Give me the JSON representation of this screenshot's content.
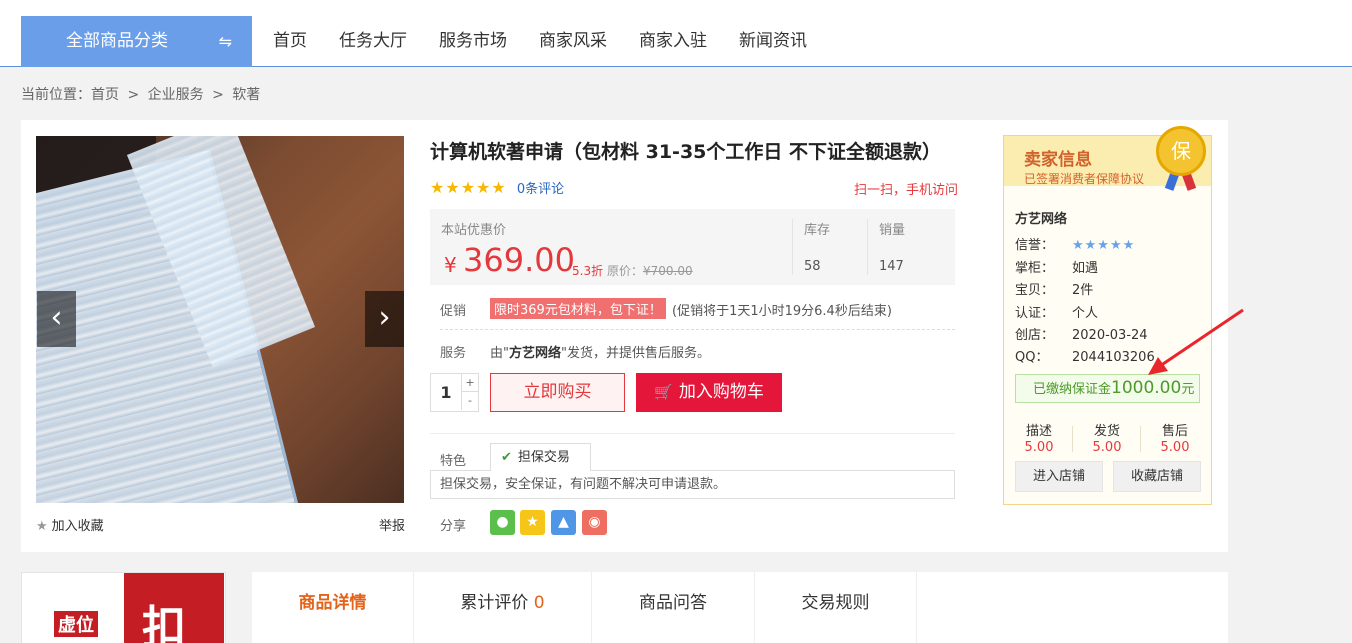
{
  "nav": {
    "all_categories": "全部商品分类",
    "swap_icon": "⇋",
    "links": [
      "首页",
      "任务大厅",
      "服务市场",
      "商家风采",
      "商家入驻",
      "新闻资讯"
    ]
  },
  "breadcrumb": {
    "prefix": "当前位置：",
    "items": [
      "首页",
      "企业服务",
      "软著"
    ],
    "separator": ">"
  },
  "product": {
    "title": "计算机软著申请（包材料 31-35个工作日 不下证全额退款）",
    "stars": "★★★★★",
    "comments": "0条评论",
    "scan_text": "扫一扫，手机访问",
    "price_label": "本站优惠价",
    "currency": "¥",
    "price": "369.00",
    "discount": "5.3折",
    "orig_label": "原价：",
    "orig_price": "¥700.00",
    "stock_label": "库存",
    "stock": "58",
    "sales_label": "销量",
    "sales": "147",
    "promo_label": "促销",
    "promo_tag": "限时369元包材料，包下证！",
    "promo_countdown": "(促销将于1天1小时19分6.4秒后结束)",
    "service_label": "服务",
    "service_pre": "由\"",
    "service_shop": "方艺网络",
    "service_post": "\"发货，并提供售后服务。",
    "qty": "1",
    "qty_plus": "+",
    "qty_minus": "-",
    "buy_now": "立即购买",
    "add_cart": "加入购物车",
    "feature_label": "特色",
    "feature_tab": "担保交易",
    "feature_desc": "担保交易，安全保证，有问题不解决可申请退款。",
    "share_label": "分享",
    "favorite": "加入收藏",
    "report": "举报"
  },
  "seller": {
    "header_title": "卖家信息",
    "header_sub": "已签署消费者保障协议",
    "medal": "保",
    "shop_name": "方艺网络",
    "credit_label": "信誉：",
    "credit_stars": "★★★★★",
    "owner_label": "掌柜：",
    "owner": "如遇",
    "items_label": "宝贝：",
    "items": "2件",
    "cert_label": "认证：",
    "cert": "个人",
    "created_label": "创店：",
    "created": "2020-03-24",
    "qq_label": "QQ：",
    "qq": "2044103206",
    "deposit_pre": "已缴纳保证金",
    "deposit_amt": "1000.00",
    "deposit_unit": "元",
    "scores": [
      {
        "label": "描述",
        "value": "5.00"
      },
      {
        "label": "发货",
        "value": "5.00"
      },
      {
        "label": "售后",
        "value": "5.00"
      }
    ],
    "enter_shop": "进入店铺",
    "fav_shop": "收藏店铺"
  },
  "tabs": {
    "detail": "商品详情",
    "reviews": "累计评价",
    "reviews_count": "0",
    "qa": "商品问答",
    "rules": "交易规则"
  },
  "logo": {
    "text1": "虚位",
    "text2": "扣"
  },
  "colors": {
    "accent_red": "#e4393c",
    "nav_blue": "#6a9ee8",
    "seller_orange": "#d2622d",
    "deposit_green": "#4e9a2a"
  }
}
